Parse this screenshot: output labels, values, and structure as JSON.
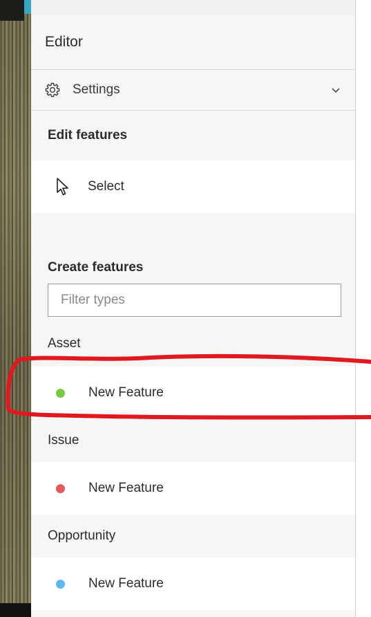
{
  "editor": {
    "title": "Editor",
    "settings_label": "Settings",
    "settings_icon": "gear-icon",
    "chevron_icon": "chevron-down-icon"
  },
  "edit_features": {
    "title": "Edit features",
    "select_label": "Select",
    "select_icon": "cursor-arrow-icon"
  },
  "create_features": {
    "title": "Create features",
    "filter_placeholder": "Filter types",
    "filter_value": "",
    "groups": [
      {
        "label": "Asset",
        "feature_label": "New Feature",
        "color": "#7ac943"
      },
      {
        "label": "Issue",
        "feature_label": "New Feature",
        "color": "#e05a5a"
      },
      {
        "label": "Opportunity",
        "feature_label": "New Feature",
        "color": "#5cb8ee"
      }
    ]
  },
  "colors": {
    "panel_background": "#f8f6f4",
    "map_accent": "#37a6c4",
    "annotation_stroke": "#e0181f"
  }
}
